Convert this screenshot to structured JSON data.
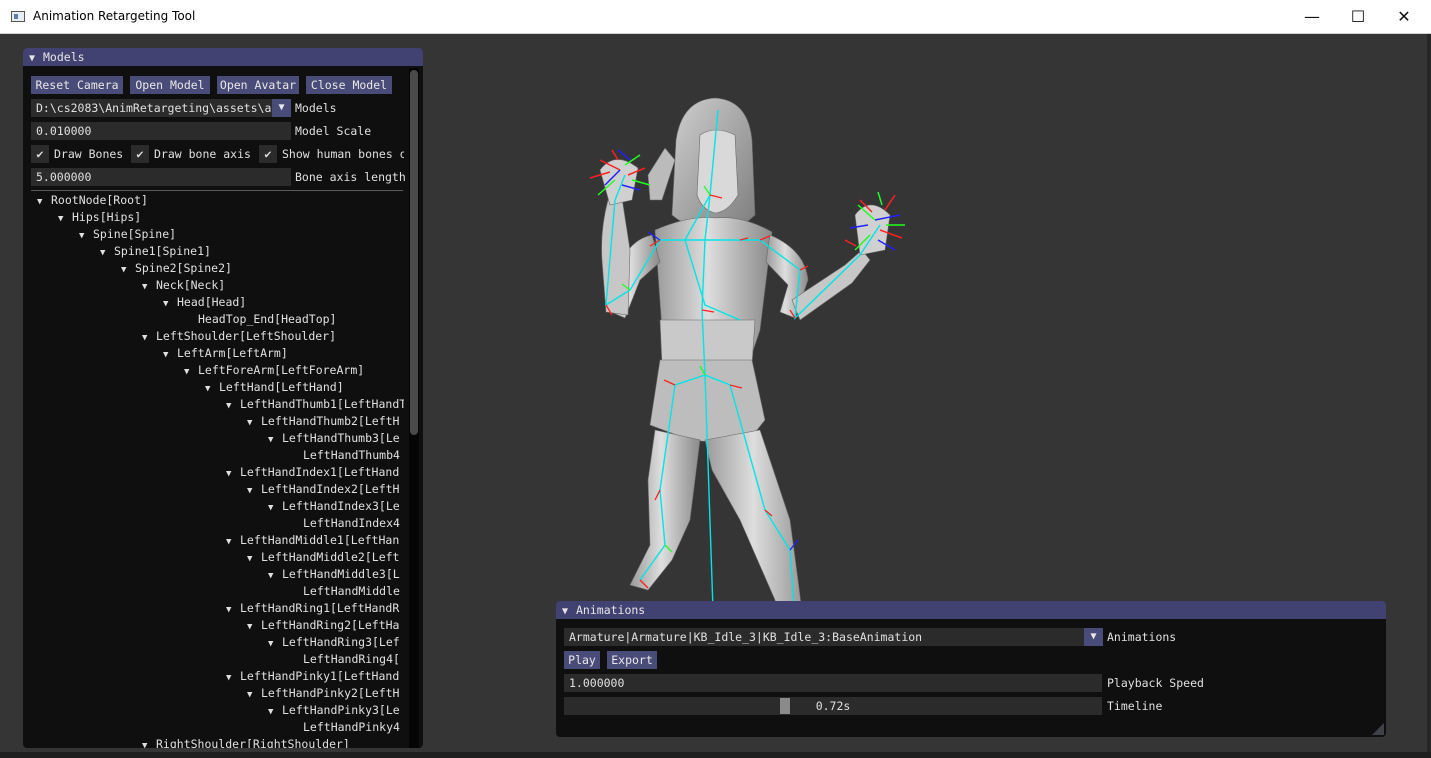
{
  "window": {
    "title": "Animation Retargeting Tool",
    "minimize_glyph": "—",
    "maximize_glyph": "☐",
    "close_glyph": "✕"
  },
  "models_panel": {
    "title": "Models",
    "buttons": [
      "Reset Camera",
      "Open Model",
      "Open Avatar",
      "Close Model"
    ],
    "path_value": "D:\\cs2083\\AnimRetargeting\\assets\\a",
    "path_label": "Models",
    "scale_value": "0.010000",
    "scale_label": "Model Scale",
    "checkboxes": [
      {
        "label": "Draw Bones",
        "checked": true
      },
      {
        "label": "Draw bone axis",
        "checked": true
      },
      {
        "label": "Show human bones o",
        "checked": true
      }
    ],
    "axis_length_value": "5.000000",
    "axis_length_label": "Bone axis length",
    "tree": [
      {
        "label": "RootNode[Root]",
        "depth": 0,
        "expanded": true
      },
      {
        "label": "Hips[Hips]",
        "depth": 1,
        "expanded": true
      },
      {
        "label": "Spine[Spine]",
        "depth": 2,
        "expanded": true
      },
      {
        "label": "Spine1[Spine1]",
        "depth": 3,
        "expanded": true
      },
      {
        "label": "Spine2[Spine2]",
        "depth": 4,
        "expanded": true
      },
      {
        "label": "Neck[Neck]",
        "depth": 5,
        "expanded": true
      },
      {
        "label": "Head[Head]",
        "depth": 6,
        "expanded": true
      },
      {
        "label": "HeadTop_End[HeadTop]",
        "depth": 7,
        "expanded": false
      },
      {
        "label": "LeftShoulder[LeftShoulder]",
        "depth": 5,
        "expanded": true
      },
      {
        "label": "LeftArm[LeftArm]",
        "depth": 6,
        "expanded": true
      },
      {
        "label": "LeftForeArm[LeftForeArm]",
        "depth": 7,
        "expanded": true
      },
      {
        "label": "LeftHand[LeftHand]",
        "depth": 8,
        "expanded": true
      },
      {
        "label": "LeftHandThumb1[LeftHandT",
        "depth": 9,
        "expanded": true
      },
      {
        "label": "LeftHandThumb2[LeftH",
        "depth": 10,
        "expanded": true
      },
      {
        "label": "LeftHandThumb3[Le",
        "depth": 11,
        "expanded": true
      },
      {
        "label": "LeftHandThumb4",
        "depth": 12,
        "expanded": false
      },
      {
        "label": "LeftHandIndex1[LeftHand",
        "depth": 9,
        "expanded": true
      },
      {
        "label": "LeftHandIndex2[LeftH",
        "depth": 10,
        "expanded": true
      },
      {
        "label": "LeftHandIndex3[Le",
        "depth": 11,
        "expanded": true
      },
      {
        "label": "LeftHandIndex4",
        "depth": 12,
        "expanded": false
      },
      {
        "label": "LeftHandMiddle1[LeftHan",
        "depth": 9,
        "expanded": true
      },
      {
        "label": "LeftHandMiddle2[Left",
        "depth": 10,
        "expanded": true
      },
      {
        "label": "LeftHandMiddle3[L",
        "depth": 11,
        "expanded": true
      },
      {
        "label": "LeftHandMiddle",
        "depth": 12,
        "expanded": false
      },
      {
        "label": "LeftHandRing1[LeftHandR",
        "depth": 9,
        "expanded": true
      },
      {
        "label": "LeftHandRing2[LeftHa",
        "depth": 10,
        "expanded": true
      },
      {
        "label": "LeftHandRing3[Lef",
        "depth": 11,
        "expanded": true
      },
      {
        "label": "LeftHandRing4[",
        "depth": 12,
        "expanded": false
      },
      {
        "label": "LeftHandPinky1[LeftHand",
        "depth": 9,
        "expanded": true
      },
      {
        "label": "LeftHandPinky2[LeftH",
        "depth": 10,
        "expanded": true
      },
      {
        "label": "LeftHandPinky3[Le",
        "depth": 11,
        "expanded": true
      },
      {
        "label": "LeftHandPinky4",
        "depth": 12,
        "expanded": false
      },
      {
        "label": "RightShoulder[RightShoulder]",
        "depth": 5,
        "expanded": true
      }
    ]
  },
  "animations_panel": {
    "title": "Animations",
    "clip_value": "Armature|Armature|KB_Idle_3|KB_Idle_3:BaseAnimation",
    "clip_label": "Animations",
    "play_label": "Play",
    "export_label": "Export",
    "speed_value": "1.000000",
    "speed_label": "Playback Speed",
    "timeline_value": "0.72s",
    "timeline_label": "Timeline",
    "timeline_fraction": 0.41
  },
  "colors": {
    "viewport_bg": "#353535",
    "panel_bg": "#0f0f10",
    "header_bg": "#424272",
    "button_bg": "#494c78",
    "bone_line": "#00e5e5",
    "axis_x": "#ff2020",
    "axis_y": "#20ff20",
    "axis_z": "#2020ff"
  }
}
